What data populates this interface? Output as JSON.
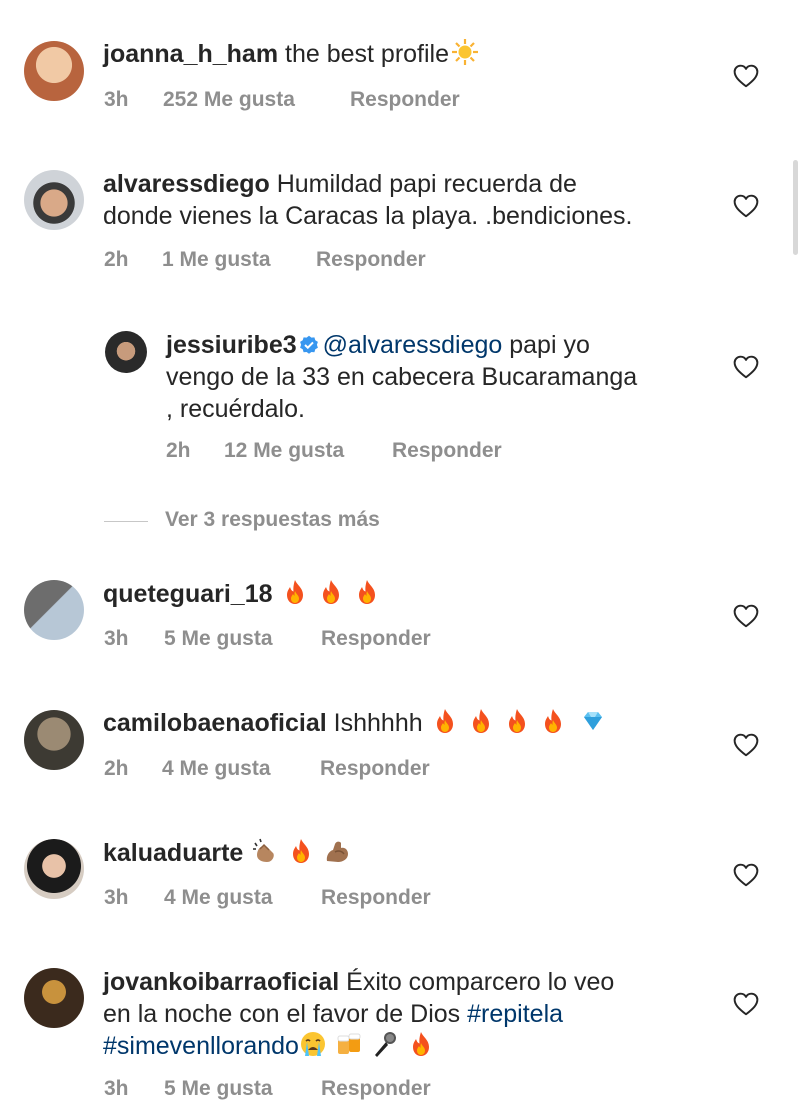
{
  "comments": [
    {
      "username": "joanna_h_ham",
      "text": "the best profile",
      "emoji": "sun-emoji",
      "time": "3h",
      "likes": "252 Me gusta",
      "reply": "Responder"
    },
    {
      "username": "alvaressdiego",
      "line1": "Humildad papi recuerda de",
      "line2": "donde vienes la Caracas la playa. .bendiciones.",
      "time": "2h",
      "likes": "1 Me gusta",
      "reply": "Responder"
    },
    {
      "username": "jessiuribe3",
      "mention": "@alvaressdiego",
      "line1_rest": "papi yo",
      "line2": "vengo de la 33 en cabecera Bucaramanga",
      "line3": ", recuérdalo.",
      "time": "2h",
      "likes": "12 Me gusta",
      "reply": "Responder",
      "verified": true
    },
    {
      "username": "queteguari_18",
      "emojis": [
        "fire-emoji",
        "fire-emoji",
        "fire-emoji"
      ],
      "time": "3h",
      "likes": "5 Me gusta",
      "reply": "Responder"
    },
    {
      "username": "camilobaenaoficial",
      "text": "Ishhhhh",
      "emojis": [
        "fire-emoji",
        "fire-emoji",
        "fire-emoji",
        "fire-emoji",
        "gem-emoji"
      ],
      "time": "2h",
      "likes": "4 Me gusta",
      "reply": "Responder"
    },
    {
      "username": "kaluaduarte",
      "emojis": [
        "clapping-hands-emoji",
        "fire-emoji",
        "flexed-biceps-emoji"
      ],
      "time": "3h",
      "likes": "4 Me gusta",
      "reply": "Responder"
    },
    {
      "username": "jovankoibarraoficial",
      "line1": "Éxito comparcero lo veo",
      "line2_text": "en la noche con el favor de Dios",
      "hashtag1": "#repitela",
      "hashtag2": "#simevenllorando",
      "emojis": [
        "crying-emoji",
        "beer-emoji",
        "microphone-emoji",
        "fire-emoji"
      ],
      "time": "3h",
      "likes": "5 Me gusta",
      "reply": "Responder"
    }
  ],
  "view_more_replies": "Ver 3 respuestas más",
  "colors": {
    "text": "#262626",
    "meta": "#8e8e8e",
    "link": "#00376b",
    "verified": "#3897f0"
  }
}
